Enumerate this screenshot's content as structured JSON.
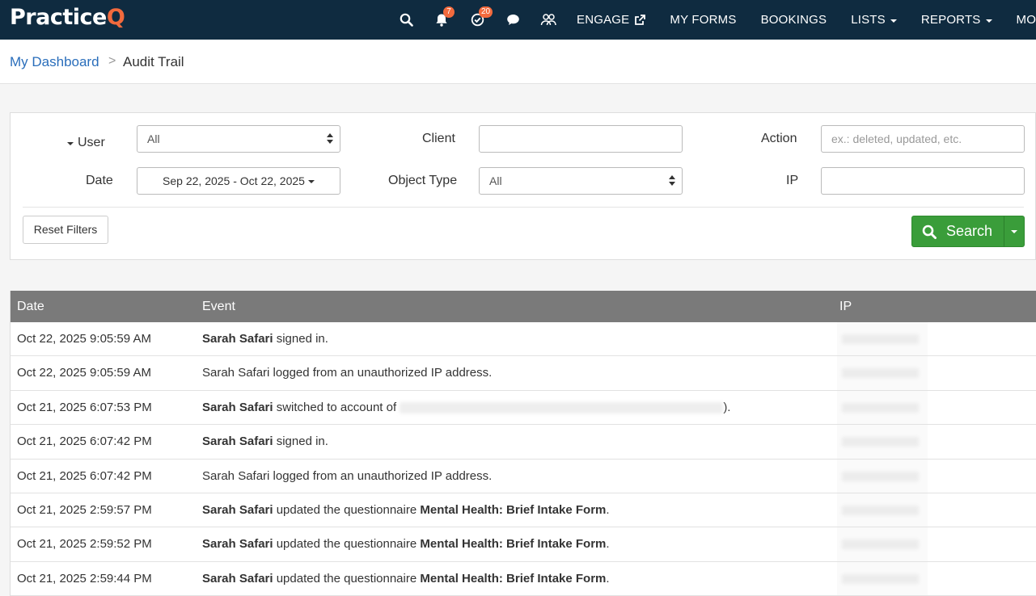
{
  "brand": {
    "name_main": "Practice",
    "name_accent": "Q"
  },
  "nav": {
    "badges": {
      "notifications": "7",
      "tasks": "20"
    },
    "links": [
      {
        "label": "ENGAGE"
      },
      {
        "label": "MY FORMS"
      },
      {
        "label": "BOOKINGS"
      },
      {
        "label": "LISTS"
      },
      {
        "label": "REPORTS"
      },
      {
        "label": "MORE"
      }
    ]
  },
  "breadcrumb": {
    "home": "My Dashboard",
    "separator": ">",
    "current": "Audit Trail"
  },
  "filters": {
    "user_label": "User",
    "user_value": "All",
    "client_label": "Client",
    "client_value": "",
    "action_label": "Action",
    "action_placeholder": "ex.: deleted, updated, etc.",
    "date_label": "Date",
    "date_value": "Sep 22, 2025 - Oct 22, 2025",
    "object_type_label": "Object Type",
    "object_type_value": "All",
    "ip_label": "IP",
    "ip_value": "",
    "reset_label": "Reset Filters",
    "search_label": "Search"
  },
  "table": {
    "headers": {
      "date": "Date",
      "event": "Event",
      "ip": "IP"
    },
    "rows": [
      {
        "date": "Oct 22, 2025 9:05:59 AM",
        "actor": "Sarah Safari",
        "actor_bold": true,
        "text": " signed in.",
        "object": "",
        "tail": ""
      },
      {
        "date": "Oct 22, 2025 9:05:59 AM",
        "actor": "Sarah Safari",
        "actor_bold": false,
        "text": " logged from an unauthorized IP address.",
        "object": "",
        "tail": ""
      },
      {
        "date": "Oct 21, 2025 6:07:53 PM",
        "actor": "Sarah Safari",
        "actor_bold": true,
        "text": " switched to account of ",
        "object": "",
        "tail": ")."
      },
      {
        "date": "Oct 21, 2025 6:07:42 PM",
        "actor": "Sarah Safari",
        "actor_bold": true,
        "text": " signed in.",
        "object": "",
        "tail": ""
      },
      {
        "date": "Oct 21, 2025 6:07:42 PM",
        "actor": "Sarah Safari",
        "actor_bold": false,
        "text": " logged from an unauthorized IP address.",
        "object": "",
        "tail": ""
      },
      {
        "date": "Oct 21, 2025 2:59:57 PM",
        "actor": "Sarah Safari",
        "actor_bold": true,
        "text": " updated the questionnaire ",
        "object": "Mental Health: Brief Intake Form",
        "tail": "."
      },
      {
        "date": "Oct 21, 2025 2:59:52 PM",
        "actor": "Sarah Safari",
        "actor_bold": true,
        "text": " updated the questionnaire ",
        "object": "Mental Health: Brief Intake Form",
        "tail": "."
      },
      {
        "date": "Oct 21, 2025 2:59:44 PM",
        "actor": "Sarah Safari",
        "actor_bold": true,
        "text": " updated the questionnaire ",
        "object": "Mental Health: Brief Intake Form",
        "tail": "."
      }
    ]
  },
  "colors": {
    "nav_bg": "#0f2b40",
    "accent": "#f26a3d",
    "search_green": "#3a9d3a",
    "table_header": "#7a7a7a",
    "link_blue": "#2a6ebb"
  },
  "icons": [
    "search-icon",
    "bell-icon",
    "check-circle-icon",
    "chat-icon",
    "people-icon",
    "external-link-icon",
    "magnifier-icon"
  ]
}
